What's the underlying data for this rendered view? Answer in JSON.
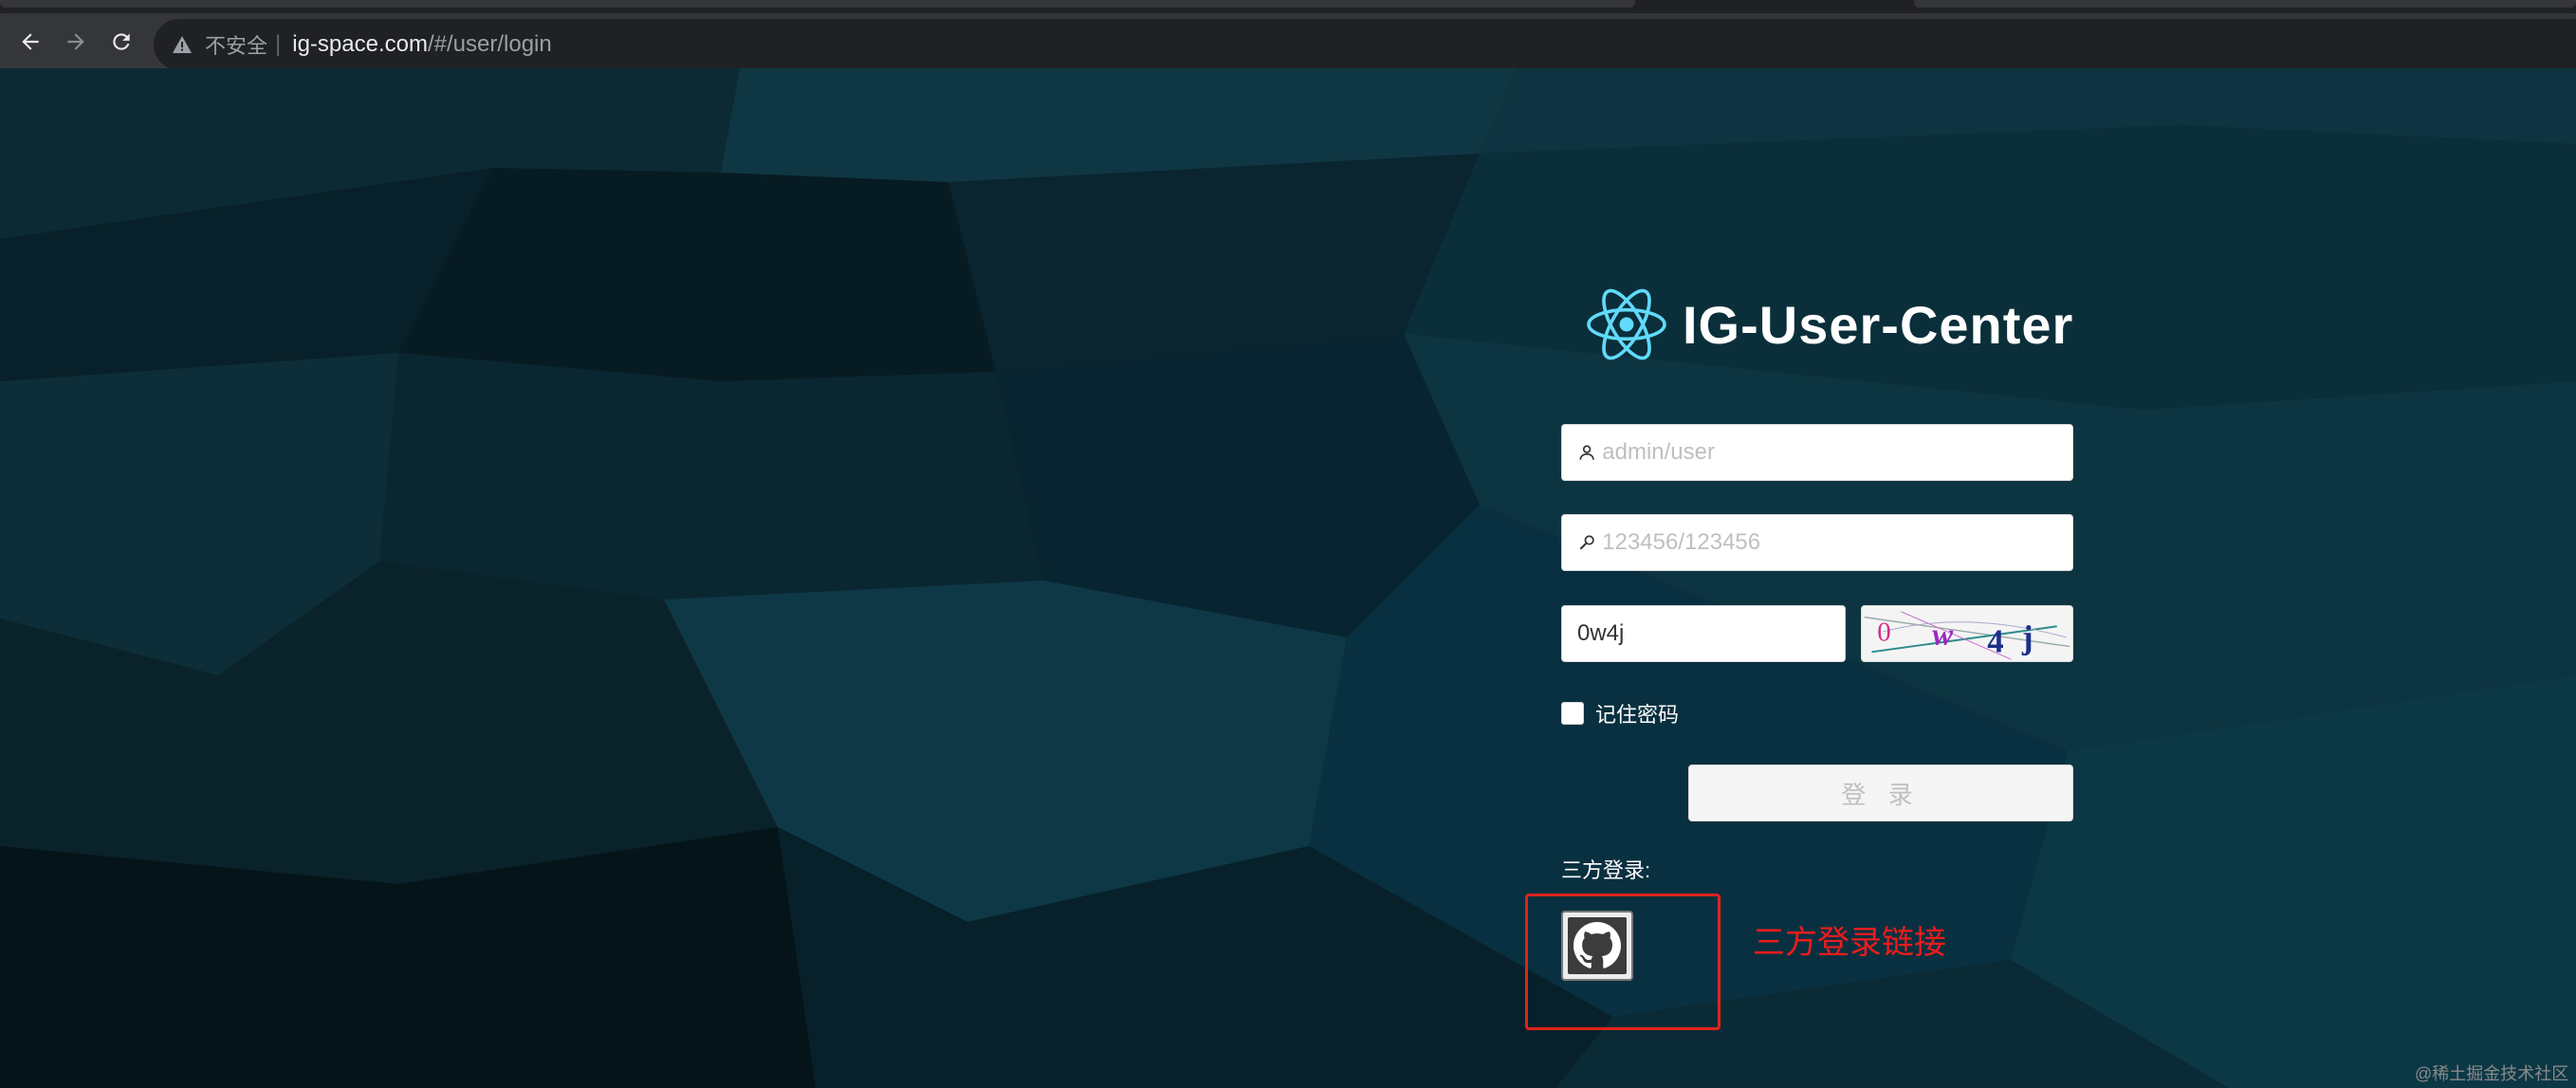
{
  "browser": {
    "security_text": "不安全",
    "url_host": "ig-space.com",
    "url_path": "/#/user/login"
  },
  "brand": {
    "title": "IG-User-Center",
    "logo_icon": "react-atom-icon",
    "logo_color": "#61dafb"
  },
  "login_form": {
    "username_placeholder": "admin/user",
    "password_placeholder": "123456/123456",
    "captcha_value": "0w4j",
    "captcha_image_text": "0w4j",
    "remember_label": "记住密码",
    "remember_checked": false,
    "submit_label": "登 录"
  },
  "third_party": {
    "label": "三方登录:",
    "providers": [
      {
        "name": "github",
        "icon": "github-icon"
      }
    ],
    "annotation": "三方登录链接",
    "annotation_color": "#ee1c1c"
  },
  "watermark": "@稀土掘金技术社区"
}
